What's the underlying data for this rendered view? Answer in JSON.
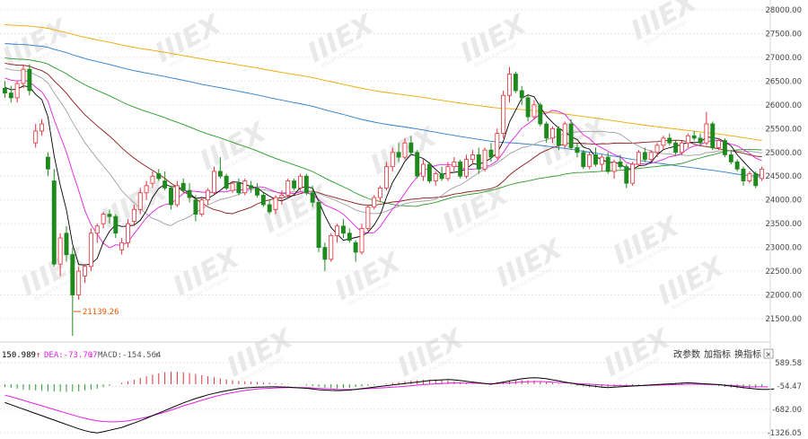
{
  "toolbar": {
    "params_label": "改参数",
    "add_indicator_label": "加指标",
    "switch_indicator_label": "换指标",
    "close_symbol": "×"
  },
  "macd_legend": {
    "dif": "150.989",
    "dif_arrow": "↑",
    "dea": "DEA:-73.707",
    "dea_arrow": "↓",
    "macd": "MACD:-154.564",
    "macd_arrow": "↑"
  },
  "watermark": {
    "text": "IIIEX",
    "sub": "Bitcoin Exchange"
  },
  "chart_data": [
    {
      "type": "candlestick",
      "y_ticks": [
        "28000.00",
        "27500.00",
        "27000.00",
        "26500.00",
        "26000.00",
        "25500.00",
        "25000.00",
        "24500.00",
        "24000.00",
        "23500.00",
        "23000.00",
        "22500.00",
        "22000.00",
        "21500.00"
      ],
      "ylim": [
        21000,
        28000
      ],
      "annotation": "21139.26",
      "colors": {
        "up": "#e0303a",
        "down": "#1e8a1e",
        "ma_short": "#000000",
        "ma2": "#e020e0",
        "ma3": "#a0a0a0",
        "ma4": "#8b1a1a",
        "ma5": "#2a9a2a",
        "ma6": "#2a7fcc",
        "ma7": "#f0a800"
      },
      "candles": [
        [
          26350,
          26500,
          26150,
          26250
        ],
        [
          26250,
          26400,
          26050,
          26150
        ],
        [
          26150,
          26500,
          26050,
          26450
        ],
        [
          26450,
          26850,
          26350,
          26750
        ],
        [
          26750,
          26850,
          26200,
          26300
        ],
        [
          25200,
          25600,
          25100,
          25450
        ],
        [
          25450,
          25700,
          25350,
          25600
        ],
        [
          24900,
          25000,
          24500,
          24650
        ],
        [
          24400,
          24650,
          22600,
          22650
        ],
        [
          22650,
          23300,
          22400,
          23200
        ],
        [
          23300,
          23450,
          22700,
          22850
        ],
        [
          22850,
          23000,
          21139.26,
          22000
        ],
        [
          22000,
          22600,
          21900,
          22500
        ],
        [
          22400,
          22650,
          22250,
          22600
        ],
        [
          22600,
          23400,
          22500,
          23300
        ],
        [
          23300,
          23500,
          23100,
          23450
        ],
        [
          23500,
          23750,
          23400,
          23700
        ],
        [
          23700,
          23800,
          23500,
          23650
        ],
        [
          23650,
          23700,
          23200,
          23300
        ],
        [
          22950,
          23200,
          22850,
          23100
        ],
        [
          23100,
          23600,
          23000,
          23500
        ],
        [
          23550,
          23900,
          23450,
          23800
        ],
        [
          23800,
          24250,
          23700,
          24150
        ],
        [
          24150,
          24400,
          24000,
          24300
        ],
        [
          24350,
          24600,
          24250,
          24500
        ],
        [
          24550,
          24650,
          24400,
          24450
        ],
        [
          24400,
          24600,
          24200,
          24250
        ],
        [
          24250,
          24300,
          23800,
          23900
        ],
        [
          23900,
          24400,
          23850,
          24300
        ],
        [
          24350,
          24450,
          24150,
          24200
        ],
        [
          24200,
          24350,
          23950,
          24050
        ],
        [
          24000,
          24100,
          23550,
          23700
        ],
        [
          23700,
          24050,
          23650,
          24000
        ],
        [
          24000,
          24250,
          23900,
          24200
        ],
        [
          24150,
          24700,
          24100,
          24600
        ],
        [
          24600,
          24900,
          24450,
          24500
        ],
        [
          24500,
          24550,
          24200,
          24250
        ],
        [
          24200,
          24400,
          24150,
          24350
        ],
        [
          24350,
          24450,
          24100,
          24150
        ],
        [
          24150,
          24450,
          24100,
          24400
        ],
        [
          24300,
          24400,
          24150,
          24250
        ],
        [
          24250,
          24350,
          24050,
          24100
        ],
        [
          24100,
          24150,
          23850,
          23900
        ],
        [
          23900,
          24000,
          23700,
          23750
        ],
        [
          23800,
          24100,
          23700,
          24050
        ],
        [
          24050,
          24200,
          23900,
          24100
        ],
        [
          24100,
          24450,
          24050,
          24400
        ],
        [
          24400,
          24450,
          24200,
          24250
        ],
        [
          24250,
          24550,
          24200,
          24500
        ],
        [
          24500,
          24550,
          24100,
          24150
        ],
        [
          24150,
          24300,
          23850,
          23950
        ],
        [
          23950,
          24000,
          22900,
          23000
        ],
        [
          23000,
          23100,
          22500,
          22750
        ],
        [
          22750,
          23300,
          22700,
          23250
        ],
        [
          23250,
          23500,
          23100,
          23450
        ],
        [
          23450,
          23600,
          23200,
          23300
        ],
        [
          23300,
          23400,
          23100,
          23150
        ],
        [
          23100,
          23150,
          22700,
          22900
        ],
        [
          22900,
          23500,
          22850,
          23400
        ],
        [
          23400,
          23900,
          23350,
          23850
        ],
        [
          23850,
          24100,
          23800,
          24050
        ],
        [
          24050,
          24300,
          23950,
          24250
        ],
        [
          24250,
          24800,
          24200,
          24700
        ],
        [
          24700,
          25100,
          24600,
          25000
        ],
        [
          25000,
          25200,
          24800,
          24900
        ],
        [
          24900,
          25300,
          24850,
          25200
        ],
        [
          25200,
          25350,
          24950,
          25000
        ],
        [
          25000,
          25050,
          24450,
          24500
        ],
        [
          24500,
          24850,
          24400,
          24750
        ],
        [
          24750,
          24800,
          24350,
          24400
        ],
        [
          24400,
          24600,
          24300,
          24550
        ],
        [
          24550,
          24700,
          24400,
          24450
        ],
        [
          24450,
          24800,
          24400,
          24700
        ],
        [
          24700,
          24900,
          24600,
          24800
        ],
        [
          24800,
          24850,
          24450,
          24500
        ],
        [
          24500,
          24950,
          24450,
          24850
        ],
        [
          24850,
          25050,
          24750,
          24950
        ],
        [
          24950,
          25100,
          24550,
          24650
        ],
        [
          24650,
          25100,
          24600,
          25050
        ],
        [
          25050,
          25200,
          24800,
          24900
        ],
        [
          24900,
          25500,
          24850,
          25400
        ],
        [
          25400,
          26300,
          25300,
          26200
        ],
        [
          26200,
          26800,
          26050,
          26650
        ],
        [
          26650,
          26700,
          26250,
          26300
        ],
        [
          26300,
          26400,
          26000,
          26150
        ],
        [
          26150,
          26200,
          25650,
          25750
        ],
        [
          25750,
          26100,
          25700,
          26000
        ],
        [
          26000,
          26050,
          25550,
          25600
        ],
        [
          25600,
          25650,
          25200,
          25300
        ],
        [
          25300,
          25550,
          25200,
          25500
        ],
        [
          25500,
          25550,
          25050,
          25150
        ],
        [
          25150,
          25650,
          25100,
          25600
        ],
        [
          25600,
          25700,
          25050,
          25100
        ],
        [
          25100,
          25200,
          24900,
          25000
        ],
        [
          25000,
          25050,
          24650,
          24700
        ],
        [
          24700,
          25000,
          24650,
          24950
        ],
        [
          24950,
          25100,
          24700,
          24750
        ],
        [
          24750,
          24950,
          24600,
          24900
        ],
        [
          24900,
          25000,
          24550,
          24600
        ],
        [
          24600,
          24850,
          24450,
          24800
        ],
        [
          24800,
          24950,
          24650,
          24700
        ],
        [
          24700,
          24750,
          24250,
          24350
        ],
        [
          24350,
          24800,
          24300,
          24750
        ],
        [
          24750,
          25050,
          24700,
          25000
        ],
        [
          25000,
          25100,
          24800,
          24850
        ],
        [
          24850,
          25050,
          24800,
          25000
        ],
        [
          25000,
          25200,
          24900,
          25150
        ],
        [
          25150,
          25350,
          25050,
          25300
        ],
        [
          25300,
          25400,
          25150,
          25200
        ],
        [
          25200,
          25250,
          24950,
          25000
        ],
        [
          25000,
          25250,
          24950,
          25200
        ],
        [
          25200,
          25400,
          25100,
          25350
        ],
        [
          25350,
          25450,
          25250,
          25300
        ],
        [
          25300,
          25400,
          25150,
          25200
        ],
        [
          25200,
          25850,
          25150,
          25600
        ],
        [
          25600,
          25650,
          25050,
          25100
        ],
        [
          25100,
          25300,
          25050,
          25250
        ],
        [
          25250,
          25300,
          24900,
          24950
        ],
        [
          24950,
          25050,
          24750,
          24800
        ],
        [
          24800,
          24850,
          24600,
          24650
        ],
        [
          24650,
          24700,
          24300,
          24400
        ],
        [
          24400,
          24600,
          24350,
          24550
        ],
        [
          24550,
          24600,
          24250,
          24300
        ],
        [
          24450,
          24700,
          24400,
          24650
        ]
      ]
    },
    {
      "type": "bar",
      "title": "MACD",
      "y_ticks": [
        "589.58",
        "-54.47",
        "-682.00",
        "-1326.05"
      ],
      "ylim": [
        -1400,
        700
      ],
      "histogram": [
        -80,
        -100,
        -120,
        -150,
        -160,
        -170,
        -180,
        -190,
        -200,
        -205,
        -210,
        -200,
        -190,
        -170,
        -150,
        -120,
        -80,
        -40,
        0,
        40,
        80,
        120,
        170,
        220,
        260,
        300,
        330,
        340,
        340,
        330,
        310,
        280,
        250,
        220,
        190,
        160,
        130,
        110,
        90,
        80,
        70,
        60,
        50,
        40,
        30,
        20,
        10,
        0,
        -10,
        -30,
        -50,
        -70,
        -90,
        -110,
        -120,
        -110,
        -100,
        -80,
        -60,
        -40,
        -20,
        0,
        20,
        40,
        60,
        80,
        100,
        110,
        120,
        125,
        130,
        120,
        100,
        80,
        60,
        40,
        20,
        0,
        20,
        40,
        60,
        80,
        100,
        110,
        120,
        110,
        100,
        80,
        60,
        40,
        20,
        0,
        -20,
        -40,
        -60,
        -80,
        -90,
        -80,
        -70,
        -60,
        -50,
        -40,
        -30,
        -20,
        -10,
        0,
        10,
        20,
        30,
        40,
        30,
        20,
        10,
        0,
        -10,
        -30,
        -50,
        -70,
        -90,
        -110,
        -120,
        -115,
        -100,
        -80
      ],
      "dif": [
        -500,
        -560,
        -620,
        -680,
        -740,
        -800,
        -860,
        -920,
        -980,
        -1040,
        -1100,
        -1160,
        -1220,
        -1270,
        -1310,
        -1330,
        -1300,
        -1260,
        -1220,
        -1180,
        -1120,
        -1060,
        -1000,
        -930,
        -860,
        -790,
        -720,
        -650,
        -580,
        -510,
        -450,
        -390,
        -340,
        -290,
        -250,
        -210,
        -180,
        -150,
        -120,
        -100,
        -90,
        -80,
        -75,
        -70,
        -70,
        -75,
        -80,
        -90,
        -100,
        -110,
        -130,
        -150,
        -160,
        -170,
        -175,
        -170,
        -160,
        -140,
        -120,
        -100,
        -80,
        -60,
        -40,
        -20,
        0,
        20,
        40,
        60,
        80,
        100,
        110,
        120,
        130,
        120,
        100,
        80,
        60,
        40,
        20,
        0,
        30,
        60,
        90,
        120,
        150,
        170,
        180,
        170,
        150,
        120,
        90,
        60,
        30,
        0,
        -20,
        -40,
        -60,
        -80,
        -90,
        -80,
        -70,
        -60,
        -50,
        -40,
        -30,
        -20,
        -10,
        0,
        10,
        20,
        30,
        40,
        30,
        20,
        10,
        0,
        -10,
        -30,
        -50,
        -70,
        -90,
        -110,
        -130,
        -140,
        -140,
        -130
      ],
      "dea": [
        -300,
        -340,
        -390,
        -440,
        -490,
        -540,
        -590,
        -640,
        -690,
        -740,
        -790,
        -840,
        -890,
        -930,
        -970,
        -1000,
        -1020,
        -1030,
        -1030,
        -1020,
        -1000,
        -970,
        -940,
        -900,
        -860,
        -810,
        -760,
        -710,
        -650,
        -590,
        -540,
        -490,
        -440,
        -390,
        -340,
        -300,
        -260,
        -230,
        -200,
        -170,
        -150,
        -130,
        -120,
        -110,
        -100,
        -95,
        -90,
        -90,
        -90,
        -95,
        -100,
        -110,
        -120,
        -130,
        -140,
        -145,
        -145,
        -140,
        -130,
        -120,
        -110,
        -100,
        -90,
        -80,
        -70,
        -55,
        -40,
        -25,
        -10,
        0,
        10,
        20,
        30,
        35,
        35,
        35,
        30,
        25,
        20,
        15,
        20,
        30,
        40,
        50,
        60,
        70,
        75,
        75,
        70,
        60,
        50,
        40,
        30,
        20,
        10,
        0,
        -10,
        -20,
        -30,
        -35,
        -40,
        -40,
        -40,
        -40,
        -35,
        -30,
        -25,
        -20,
        -15,
        -10,
        -5,
        0,
        0,
        0,
        -5,
        -10,
        -15,
        -25,
        -35,
        -45,
        -55,
        -65,
        -70,
        -72,
        -74
      ]
    }
  ]
}
